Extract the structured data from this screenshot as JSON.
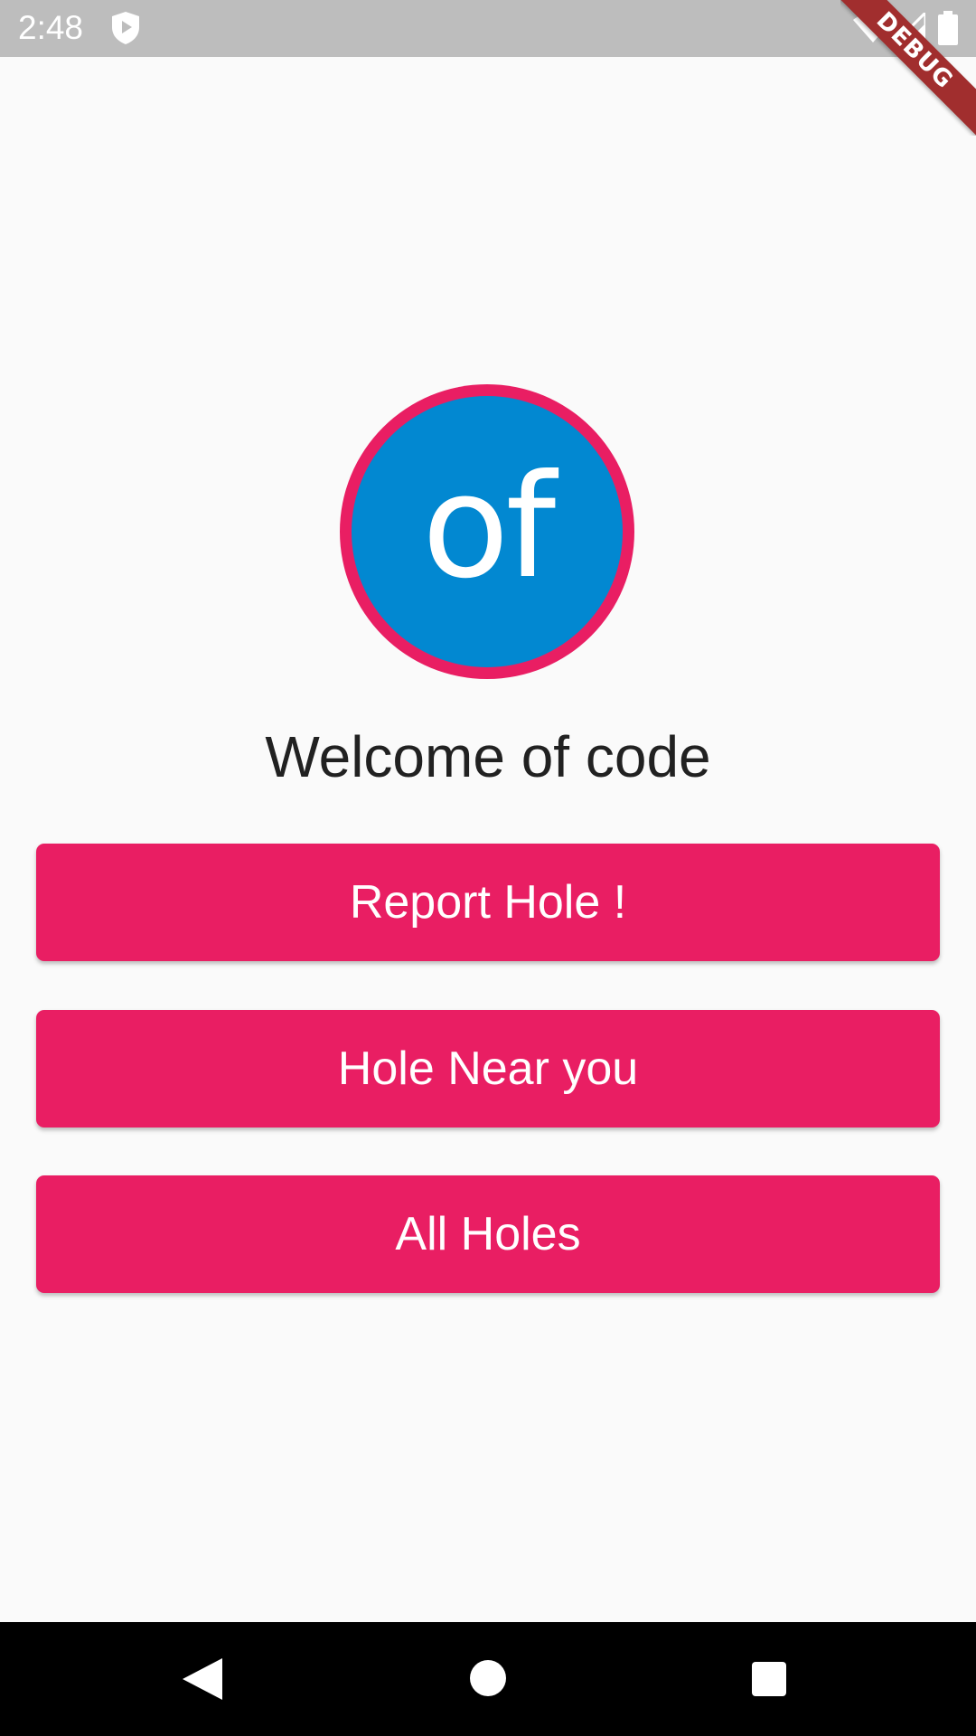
{
  "status_bar": {
    "time": "2:48",
    "background": "#bdbdbd"
  },
  "debug_banner": {
    "label": "DEBUG",
    "color": "#a12e2e"
  },
  "logo": {
    "text": "of",
    "ring_color": "#e91e63",
    "fill_color": "#0288d1"
  },
  "welcome": {
    "text": "Welcome of code"
  },
  "buttons": [
    {
      "label": "Report Hole !"
    },
    {
      "label": "Hole Near you"
    },
    {
      "label": "All Holes"
    }
  ],
  "accent_color": "#e91e63",
  "icons": {
    "status": [
      "shield-play-icon",
      "wifi-icon",
      "signal-icon",
      "battery-icon"
    ],
    "navigation": [
      "back-icon",
      "home-icon",
      "recents-icon"
    ]
  }
}
